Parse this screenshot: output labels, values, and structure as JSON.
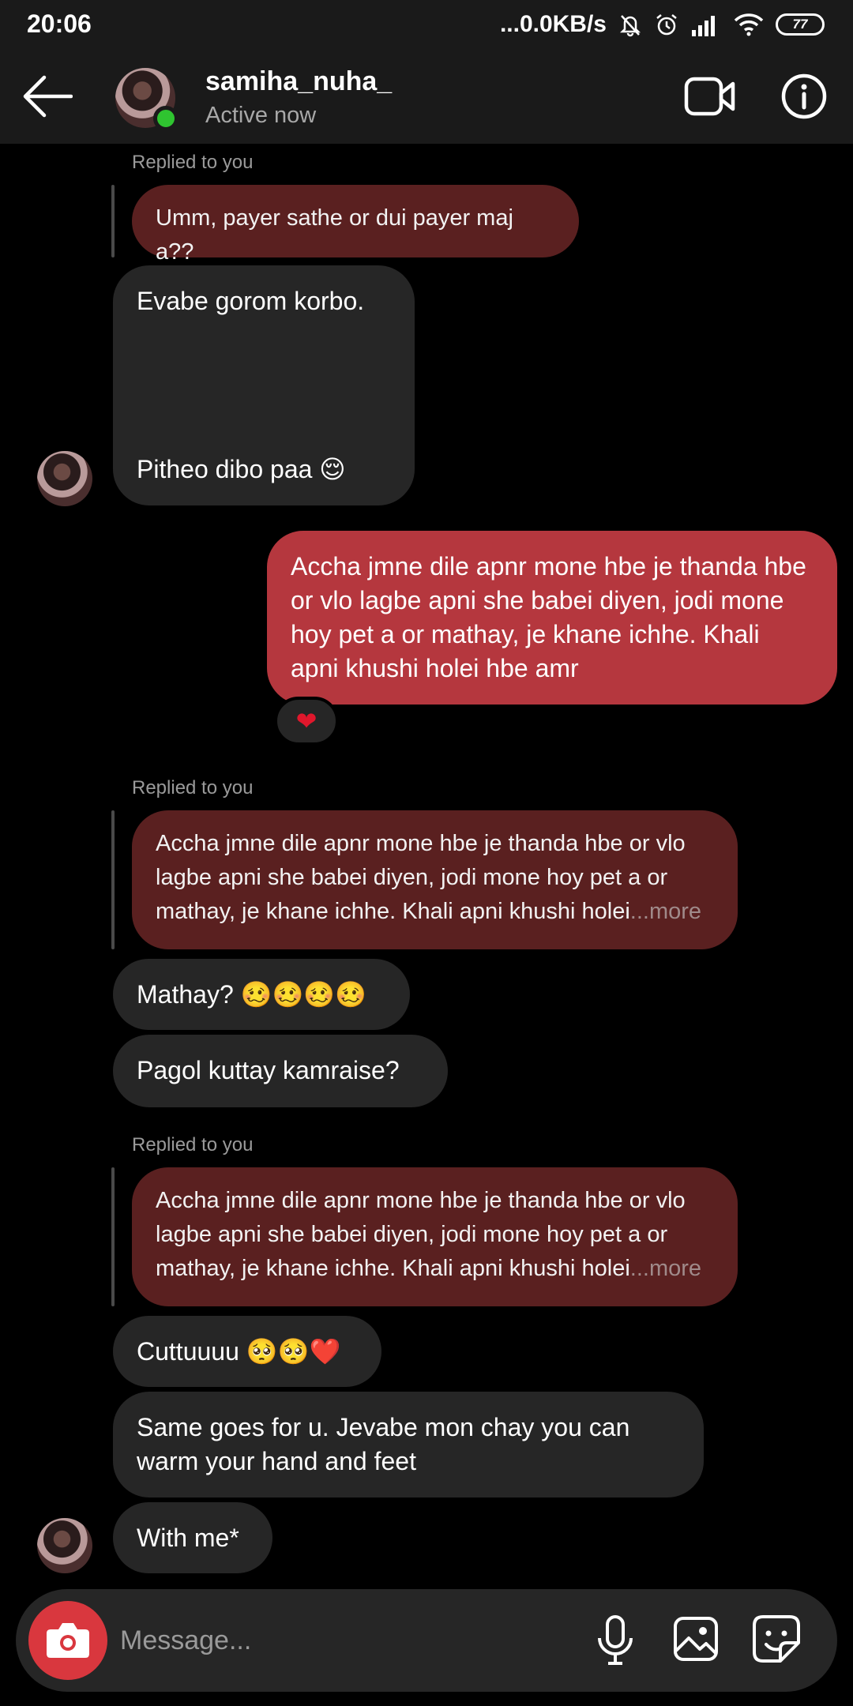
{
  "status_bar": {
    "time": "20:06",
    "network_speed": "...0.0KB/s",
    "battery": "77",
    "icons": [
      "mute-bell-icon",
      "alarm-icon",
      "signal-icon",
      "wifi-icon",
      "battery-icon"
    ]
  },
  "header": {
    "username": "samiha_nuha_",
    "status": "Active now",
    "online_color": "#2fc430"
  },
  "chat": {
    "reply_label": "Replied to you",
    "quote_1": "Umm, payer sathe or dui payer maj a??",
    "msg_1_line1": "Evabe gorom korbo.",
    "msg_1_line2": "Pitheo dibo paa 😌",
    "sent_1": "Accha jmne dile apnr mone hbe je thanda hbe or vlo lagbe apni she babei diyen, jodi mone hoy pet a or mathay, je khane ichhe. Khali apni khushi holei hbe amr",
    "reaction_1": "❤",
    "quote_2_text": "Accha jmne dile apnr mone hbe je thanda hbe or vlo lagbe apni she babei diyen, jodi mone hoy pet a or mathay, je khane ichhe. Khali apni khushi holei",
    "more": "...more",
    "msg_2": "Mathay? 🥴🥴🥴🥴",
    "msg_3": "Pagol kuttay kamraise?",
    "quote_3_text": "Accha jmne dile apnr mone hbe je thanda hbe or vlo lagbe apni she babei diyen, jodi mone hoy pet a or mathay, je khane ichhe. Khali apni khushi holei",
    "msg_4": "Cuttuuuu 🥺🥺❤️",
    "msg_5": "Same goes for u. Jevabe mon chay you can warm your hand and feet",
    "msg_6": "With me*"
  },
  "composer": {
    "placeholder": "Message..."
  },
  "colors": {
    "sent_bubble": "#b5373e",
    "received_bubble": "#262626",
    "quote_bubble": "#5a2020",
    "camera_button": "#d9373e"
  }
}
